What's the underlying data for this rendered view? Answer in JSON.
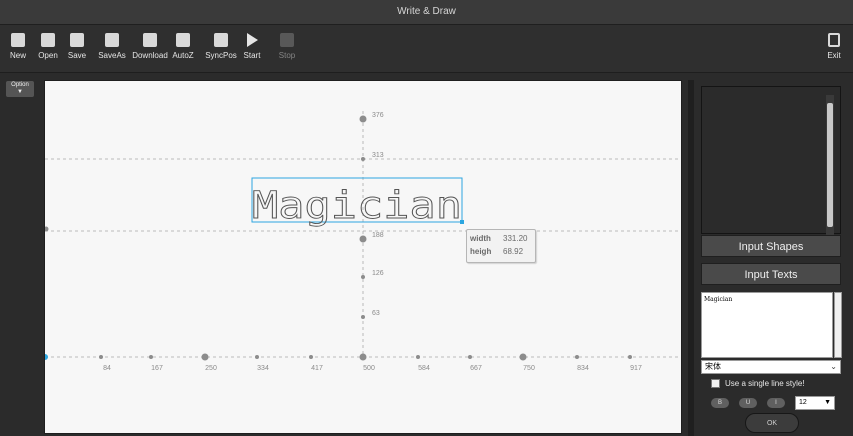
{
  "window": {
    "title": "Write & Draw"
  },
  "toolbar": {
    "buttons": [
      {
        "label": "New",
        "icon": "new-file-icon"
      },
      {
        "label": "Open",
        "icon": "folder-open-icon"
      },
      {
        "label": "Save",
        "icon": "save-icon"
      },
      {
        "label": "SaveAs",
        "icon": "save-as-icon"
      },
      {
        "label": "Download",
        "icon": "download-icon"
      },
      {
        "label": "AutoZ",
        "icon": "autoz-icon"
      },
      {
        "label": "SyncPos",
        "icon": "sync-position-icon"
      },
      {
        "label": "Start",
        "icon": "play-icon"
      },
      {
        "label": "Stop",
        "icon": "stop-icon",
        "disabled": true
      }
    ],
    "exit": {
      "label": "Exit",
      "icon": "exit-icon"
    }
  },
  "left": {
    "option_label": "Option",
    "option_arrow": "▼"
  },
  "canvas": {
    "text": "Magician",
    "x_ticks": [
      "84",
      "167",
      "250",
      "334",
      "417",
      "500",
      "584",
      "667",
      "750",
      "834",
      "917"
    ],
    "y_ticks": [
      "376",
      "313",
      "188",
      "126",
      "63"
    ],
    "selection_info": {
      "width_label": "width",
      "width_value": "331.20",
      "height_label": "heigh",
      "height_value": "68.92"
    }
  },
  "right_panel": {
    "input_shapes_label": "Input Shapes",
    "input_texts_label": "Input Texts",
    "text_input_value": "Magician",
    "font_value": "宋体",
    "single_line_label": "Use a single line style!",
    "style_buttons": [
      "B",
      "U",
      "I"
    ],
    "size_value": "12",
    "ok_label": "OK"
  },
  "colors": {
    "background": "#2b2b2b",
    "canvas": "#f7f7f7",
    "selection": "#2ca6e0",
    "axis_dot": "#8c8c8c"
  }
}
